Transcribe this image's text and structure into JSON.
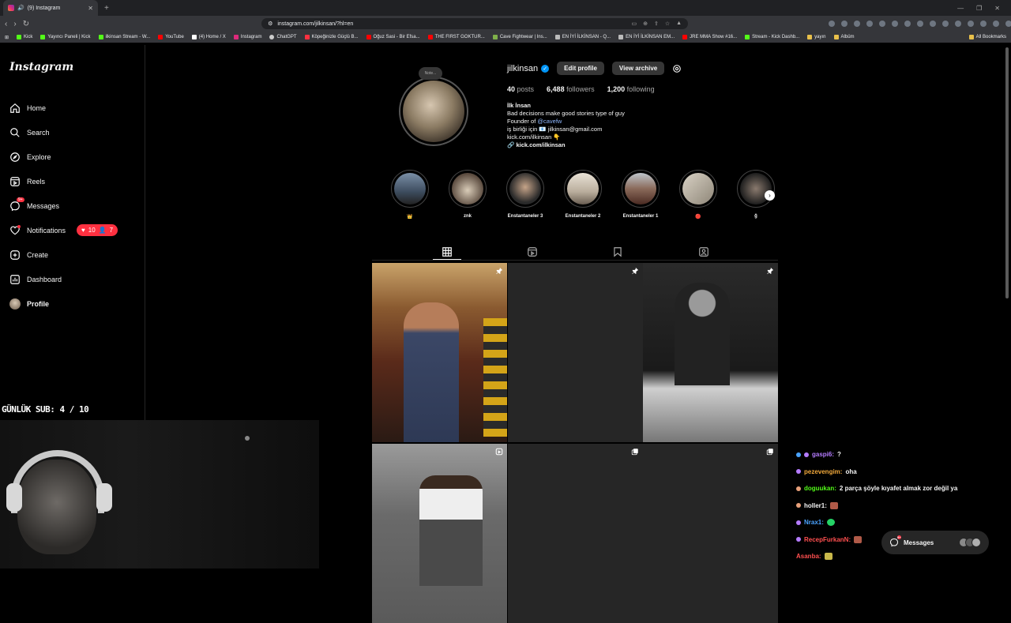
{
  "browser": {
    "tab_title": "(9) Instagram",
    "url": "instagram.com/jilkinsan/?hl=en",
    "bookmarks": [
      "Kick",
      "Yayıncı Paneli | Kick",
      "ilkinsan Stream - W...",
      "YouTube",
      "(4) Home / X",
      "Instagram",
      "ChatGPT",
      "Köpeğinizle Güçlü B...",
      "Oğuz Sasi - Bir Efsa...",
      "THE FIRST GOKTUR...",
      "Cave Fightwear | Ins...",
      "EN İYİ İLKİNSAN - Q...",
      "EN İYİ İLKİNSAN EM...",
      "JRE MMA Show #16...",
      "Stream - Kick Dashb...",
      "yayın",
      "Albüm"
    ],
    "all_bookmarks": "All Bookmarks"
  },
  "sidebar": {
    "logo": "Instagram",
    "items": [
      {
        "label": "Home",
        "icon": "home-icon"
      },
      {
        "label": "Search",
        "icon": "search-icon"
      },
      {
        "label": "Explore",
        "icon": "compass-icon"
      },
      {
        "label": "Reels",
        "icon": "reels-icon"
      },
      {
        "label": "Messages",
        "icon": "messenger-icon"
      },
      {
        "label": "Notifications",
        "icon": "heart-icon"
      },
      {
        "label": "Create",
        "icon": "plus-icon"
      },
      {
        "label": "Dashboard",
        "icon": "chart-icon"
      },
      {
        "label": "Profile",
        "icon": "avatar"
      }
    ],
    "messages_badge": "9+",
    "notif_likes": "10",
    "notif_follows": "7"
  },
  "profile": {
    "note": "Note...",
    "username": "jilkinsan",
    "edit_profile": "Edit profile",
    "view_archive": "View archive",
    "posts_count": "40",
    "posts_label": "posts",
    "followers_count": "6,488",
    "followers_label": "followers",
    "following_count": "1,200",
    "following_label": "following",
    "bio_name": "İlk İnsan",
    "bio_line1": "Bad decisions make good stories type of guy",
    "bio_founder": "Founder of",
    "bio_founder_tag": "@cavefw",
    "bio_business": "iş birliği için 📧 jilkinsan@gmail.com",
    "bio_kick": "kick.com/ilkinsan 👇",
    "bio_link": "kick.com/ilkinsan"
  },
  "highlights": [
    {
      "label": "👑"
    },
    {
      "label": "znk"
    },
    {
      "label": "Enstantaneler 3"
    },
    {
      "label": "Enstantaneler 2"
    },
    {
      "label": "Enstantaneler 1"
    },
    {
      "label": "🔴"
    },
    {
      "label": "ğ"
    }
  ],
  "stream": {
    "sub_goal": "GÜNLÜK SUB: 4 / 10"
  },
  "chat": [
    {
      "user": "gaspi6:",
      "msg": "?",
      "color": "#b57cff"
    },
    {
      "user": "pezevengim:",
      "msg": "oha",
      "color": "#f2a93b"
    },
    {
      "user": "doguukan:",
      "msg": "2 parça şöyle kıyafet almak zor değil ya",
      "color": "#53fc18"
    },
    {
      "user": "holler1:",
      "msg": "",
      "color": "#f5f5f5"
    },
    {
      "user": "Nrax1:",
      "msg": "",
      "color": "#4aa3ff"
    },
    {
      "user": "RecepFurkanN:",
      "msg": "",
      "color": "#ff4f4f"
    },
    {
      "user": "Asanba:",
      "msg": "",
      "color": "#ff4f4f"
    }
  ],
  "messages_pill": {
    "label": "Messages",
    "badge": "9+"
  },
  "colors": {
    "badge_red": "#ff3040",
    "verified_blue": "#0095f6"
  }
}
